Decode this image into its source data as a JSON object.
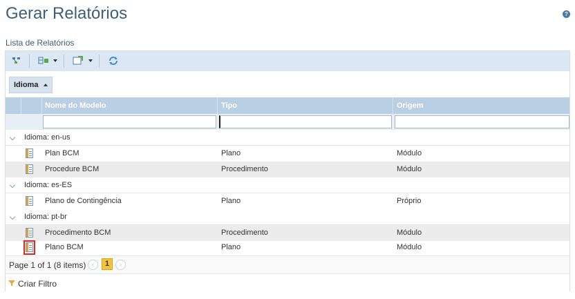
{
  "page": {
    "title": "Gerar Relatórios",
    "help_icon": "?"
  },
  "list": {
    "title": "Lista de Relatórios"
  },
  "toolbar": {
    "icons": [
      "group-by-icon",
      "columns-icon",
      "export-icon",
      "refresh-icon"
    ]
  },
  "grouping": {
    "label": "Idioma"
  },
  "columns": [
    "Nome do Modelo",
    "Tipo",
    "Origem"
  ],
  "filters": {
    "name": "",
    "type": "",
    "origin": ""
  },
  "groups": [
    {
      "label": "Idioma: en-us",
      "rows": [
        {
          "name": "Plan BCM",
          "type": "Plano",
          "origin": "Módulo"
        },
        {
          "name": "Procedure BCM",
          "type": "Procedimento",
          "origin": "Módulo"
        }
      ]
    },
    {
      "label": "Idioma: es-ES",
      "rows": [
        {
          "name": "Plano de Contingência",
          "type": "Plano",
          "origin": "Próprio"
        }
      ]
    },
    {
      "label": "Idioma: pt-br",
      "rows": [
        {
          "name": "Procedimento BCM",
          "type": "Procedimento",
          "origin": "Módulo"
        },
        {
          "name": "Plano BCM",
          "type": "Plano",
          "origin": "Módulo"
        }
      ]
    }
  ],
  "pager": {
    "text": "Page 1 of 1 (8 items)",
    "current": "1",
    "prev": "‹",
    "next": "›"
  },
  "filter_bar": {
    "label": "Criar Filtro"
  },
  "colors": {
    "title": "#3e5f7a",
    "header": "#b9cfe4",
    "toolbar": "#dbe8f4",
    "highlight": "#e0261f",
    "pager_current": "#f5c33b"
  }
}
